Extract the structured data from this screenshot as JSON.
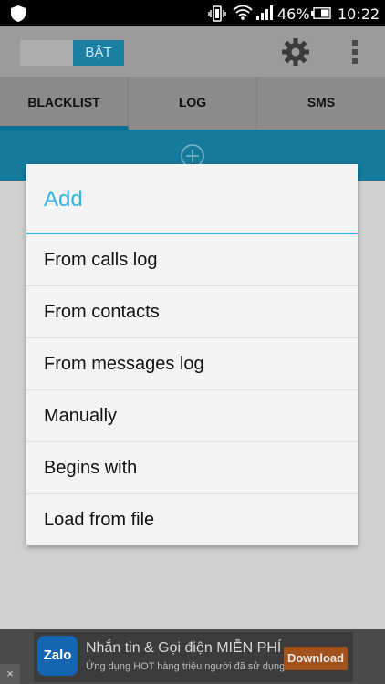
{
  "status_bar": {
    "battery_percent": "46%",
    "time": "10:22",
    "icons": [
      "shield-icon",
      "vibrate-icon",
      "wifi-icon",
      "signal-icon",
      "battery-icon"
    ]
  },
  "app_bar": {
    "toggle_label": "BẬT",
    "icons": [
      "settings-gear-icon",
      "overflow-menu-icon"
    ]
  },
  "tabs": [
    {
      "label": "BLACKLIST",
      "active": true
    },
    {
      "label": "LOG",
      "active": false
    },
    {
      "label": "SMS",
      "active": false
    }
  ],
  "dialog": {
    "title": "Add",
    "options": [
      {
        "label": "From calls log"
      },
      {
        "label": "From contacts"
      },
      {
        "label": "From messages log"
      },
      {
        "label": "Manually"
      },
      {
        "label": "Begins with"
      },
      {
        "label": "Load from file"
      }
    ]
  },
  "ad": {
    "logo_text": "Zalo",
    "title": "Nhắn tin & Gọi điện MIỄN PHÍ",
    "subtitle": "Ứng dụng HOT hàng triệu người đã sử dụng",
    "button_label": "Download",
    "close_label": "×"
  },
  "colors": {
    "accent": "#33b5e5",
    "tab_indicator": "#0b6f92",
    "dim_background": "#d2d2d2"
  }
}
